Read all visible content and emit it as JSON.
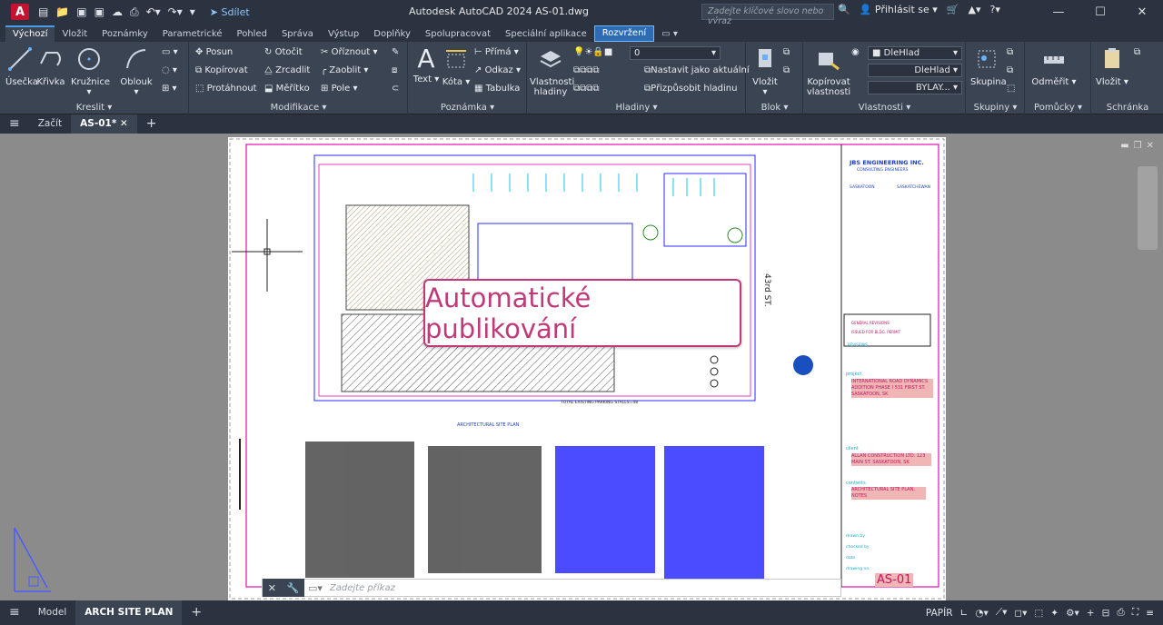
{
  "app": {
    "logo": "A",
    "title": "Autodesk AutoCAD 2024   AS-01.dwg",
    "share": "Sdílet",
    "search_placeholder": "Zadejte klíčové slovo nebo výraz",
    "signin": "Přihlásit se"
  },
  "window_controls": {
    "minimize": "—",
    "maximize": "☐",
    "close": "✕"
  },
  "ribbon_tabs": [
    "Výchozí",
    "Vložit",
    "Poznámky",
    "Parametrické",
    "Pohled",
    "Správa",
    "Výstup",
    "Doplňky",
    "Spolupracovat",
    "Speciální aplikace",
    "Rozvržení"
  ],
  "ribbon": {
    "kreslit": {
      "label": "Kreslit",
      "useckа": "Úsečka",
      "krivka": "Křivka",
      "kruznice": "Kružnice",
      "oblouk": "Oblouk"
    },
    "modifikace": {
      "label": "Modifikace",
      "posun": "Posun",
      "otocit": "Otočit",
      "oriznout": "Oříznout",
      "kopirovat": "Kopírovat",
      "zrcadlit": "Zrcadlit",
      "zaoblit": "Zaoblit",
      "protahnout": "Protáhnout",
      "meritko": "Měřítko",
      "pole": "Pole"
    },
    "poznamka": {
      "label": "Poznámka",
      "text": "Text",
      "kota": "Kóta",
      "prima": "Přímá",
      "odkaz": "Odkaz",
      "tabulka": "Tabulka"
    },
    "hladiny": {
      "label": "Hladiny",
      "vlastnosti": "Vlastnosti\nhladiny",
      "current": "0",
      "nastavit": "Nastavit jako aktuální",
      "prizpusobit": "Přizpůsobit hladinu"
    },
    "blok": {
      "label": "Blok",
      "vlozit": "Vložit"
    },
    "vlastnosti": {
      "label": "Vlastnosti",
      "kopirovat": "Kopírovat\nvlastnosti",
      "color": "DleHlad",
      "linetype": "DleHlad",
      "lineweight": "BYLAY..."
    },
    "skupiny": {
      "label": "Skupiny",
      "skupina": "Skupina"
    },
    "pomucky": {
      "label": "Pomůcky",
      "odmerit": "Odměřit"
    },
    "schranka": {
      "label": "Schránka",
      "vlozit": "Vložit"
    }
  },
  "doc_tabs": {
    "menu": "≡",
    "start": "Začít",
    "active": "AS-01*",
    "add": "+"
  },
  "drawing": {
    "company": "JBS ENGINEERING INC.",
    "company_sub": "CONSULTING ENGINEERS",
    "city1": "SASKATOON",
    "city2": "SASKATCHEWAN",
    "street": "43rd ST.",
    "sheet": "AS-01",
    "plan_title": "ARCHITECTURAL SITE PLAN",
    "parking": "TOTAL EXISTING PARKING STALLS=48",
    "project_label": "project",
    "project": "INTERNATIONAL ROAD DYNAMICS ADDITION PHASE I 531 FIRST ST. SASKATOON, SK",
    "client_label": "client",
    "client": "ALLAN CONSTRUCTION LTD. 123 MAIN ST. SASKATOON, SK",
    "contents_label": "contents",
    "contents": "ARCHITECTURAL SITE PLAN, NOTES",
    "drawn": "drawn by",
    "checked": "checked by",
    "date": "date",
    "drawing_no": "drawing no.",
    "rev1": "GENERAL REVISIONS",
    "rev2": "ISSUED FOR BLDG. PERMIT",
    "revisions": "REVISIONS"
  },
  "popup": "Automatické publikování",
  "command": {
    "placeholder": "Zadejte příkaz"
  },
  "status_tabs": {
    "menu": "≡",
    "model": "Model",
    "active": "ARCH SITE PLAN",
    "add": "+"
  },
  "status_right": {
    "paper": "PAPÍR"
  }
}
